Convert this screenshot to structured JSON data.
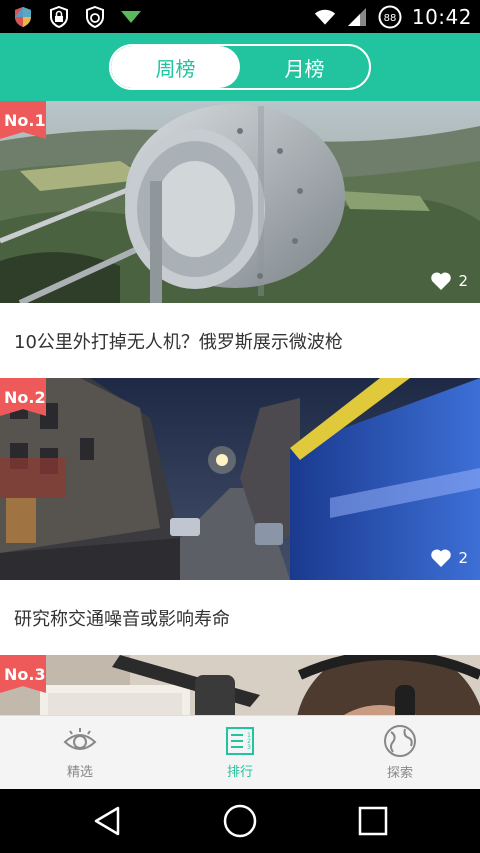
{
  "status_bar": {
    "time": "10:42",
    "battery_level": "88",
    "icons": [
      "shield-icon",
      "lock-shield-icon",
      "refresh-shield-icon",
      "download-arrow-icon",
      "wifi-icon",
      "signal-icon",
      "battery-icon"
    ]
  },
  "header": {
    "tabs": [
      {
        "label": "周榜",
        "active": true
      },
      {
        "label": "月榜",
        "active": false
      }
    ],
    "accent_color": "#22c39f"
  },
  "feed": {
    "items": [
      {
        "rank": "No.1",
        "title": "10公里外打掉无人机？俄罗斯展示微波枪",
        "likes": "2",
        "image": "microwave-dish-on-hilltop"
      },
      {
        "rank": "No.2",
        "title": "研究称交通噪音或影响寿命",
        "likes": "2",
        "image": "city-street-at-dusk-with-moving-tram"
      },
      {
        "rank": "No.3",
        "title": "",
        "likes": "",
        "image": "person-with-headphones-at-microphone"
      }
    ],
    "badge_color": "#ee5a5a"
  },
  "bottom_nav": {
    "items": [
      {
        "label": "精选",
        "icon": "eye-icon",
        "active": false
      },
      {
        "label": "排行",
        "icon": "ranking-list-icon",
        "active": true
      },
      {
        "label": "探索",
        "icon": "globe-icon",
        "active": false
      }
    ]
  },
  "system_nav": {
    "buttons": [
      "back-icon",
      "home-icon",
      "recents-icon"
    ]
  }
}
